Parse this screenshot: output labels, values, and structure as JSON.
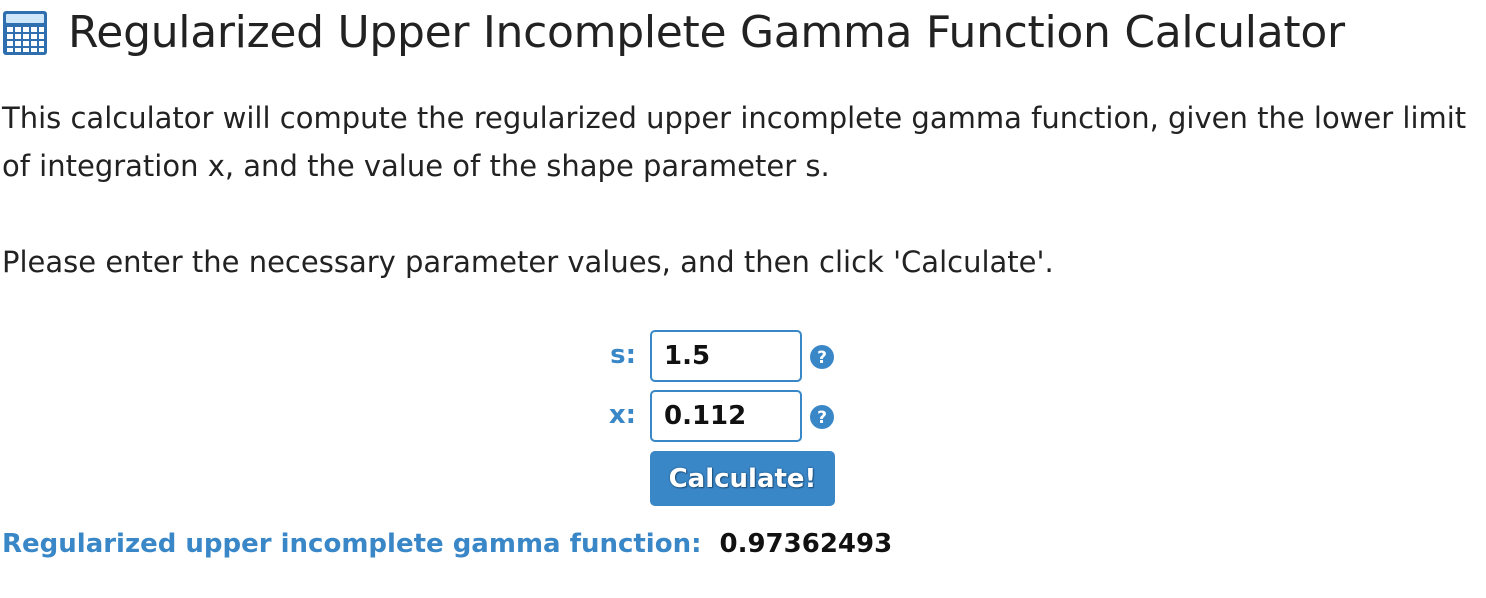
{
  "header": {
    "icon": "calculator-icon",
    "title": "Regularized Upper Incomplete Gamma Function Calculator"
  },
  "intro": {
    "description": "This calculator will compute the regularized upper incomplete gamma function, given the lower limit of integration x, and the value of the shape parameter s.",
    "instruction": "Please enter the necessary parameter values, and then click 'Calculate'."
  },
  "form": {
    "fields": [
      {
        "label": "s:",
        "value": "1.5",
        "help_icon": "question-circle-icon"
      },
      {
        "label": "x:",
        "value": "0.112",
        "help_icon": "question-circle-icon"
      }
    ],
    "submit_label": "Calculate!"
  },
  "result": {
    "label": "Regularized upper incomplete gamma function:",
    "value": "0.97362493"
  },
  "colors": {
    "accent": "#3a87c8",
    "text": "#222222",
    "background": "#ffffff"
  }
}
